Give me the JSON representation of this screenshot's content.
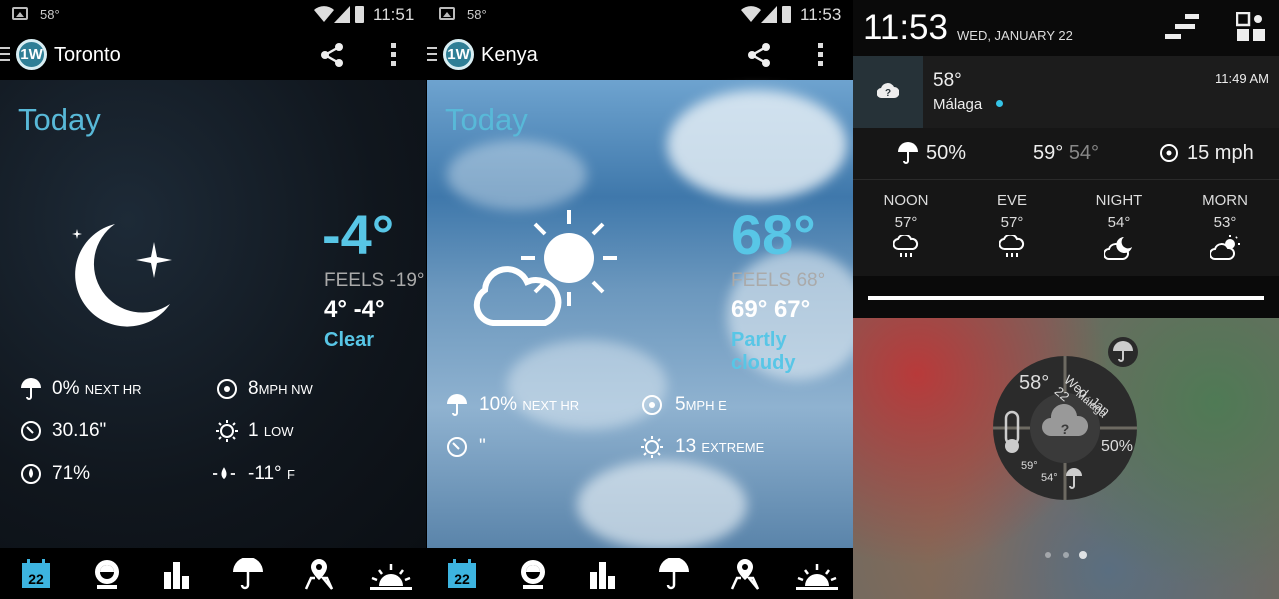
{
  "colors": {
    "accent": "#58c6e6",
    "today": "#58b9d8"
  },
  "status_bars": [
    {
      "temp": "58°",
      "time": "11:51"
    },
    {
      "temp": "58°",
      "time": "11:53"
    }
  ],
  "panels": [
    {
      "city": "Toronto",
      "today_label": "Today",
      "current_temp": "-4°",
      "feels": "FEELS -19°",
      "hi_lo": "4° -4°",
      "condition": "Clear",
      "details": {
        "precip": {
          "value": "0%",
          "unit": "NEXT HR"
        },
        "wind": {
          "value": "8",
          "unit": "MPH NW"
        },
        "pressure": {
          "value": "30.16\""
        },
        "uv": {
          "value": "1",
          "unit": "LOW"
        },
        "humidity": {
          "value": "71%"
        },
        "dewpoint": {
          "value": "-11°",
          "unit": "F"
        }
      }
    },
    {
      "city": "Kenya",
      "today_label": "Today",
      "current_temp": "68°",
      "feels": "FEELS 68°",
      "hi_lo": "69° 67°",
      "condition": "Partly cloudy",
      "details": {
        "precip": {
          "value": "10%",
          "unit": "NEXT HR"
        },
        "wind": {
          "value": "5",
          "unit": "MPH E"
        },
        "pressure": {
          "value": "\""
        },
        "uv": {
          "value": "13",
          "unit": "EXTREME"
        }
      }
    }
  ],
  "nav": {
    "calendar_day": "22",
    "icons": [
      "calendar-icon",
      "radar-icon",
      "chart-icon",
      "umbrella-icon",
      "map-icon",
      "sunrise-icon"
    ]
  },
  "notification_shade": {
    "clock": "11:53",
    "date": "WED, JANUARY 22",
    "notification": {
      "temp": "58°",
      "city": "Málaga",
      "time": "11:49 AM"
    },
    "summary": {
      "precip": "50%",
      "hi": "59°",
      "lo": "54°",
      "wind": "15 mph"
    },
    "periods": [
      {
        "name": "NOON",
        "temp": "57°",
        "icon": "rain-icon"
      },
      {
        "name": "EVE",
        "temp": "57°",
        "icon": "rain-icon"
      },
      {
        "name": "NIGHT",
        "temp": "54°",
        "icon": "night-cloudy-icon"
      },
      {
        "name": "MORN",
        "temp": "53°",
        "icon": "partly-cloudy-icon"
      }
    ],
    "widget": {
      "temp": "58°",
      "date": "Wed, Jan 22",
      "city": "Málaga",
      "precip": "50%",
      "hi": "59°",
      "lo": "54°"
    }
  }
}
